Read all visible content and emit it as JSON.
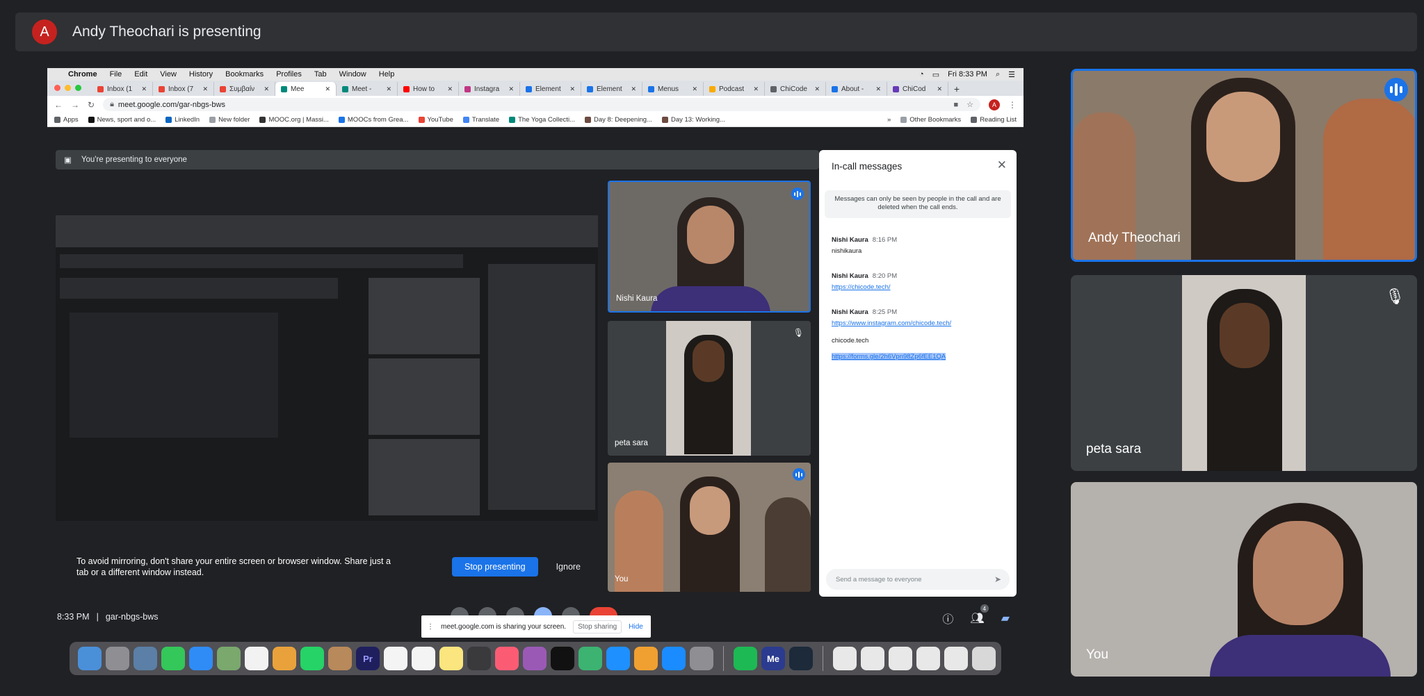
{
  "banner": {
    "avatar_letter": "A",
    "text": "Andy Theochari is presenting"
  },
  "mac_menu": {
    "items": [
      "Chrome",
      "File",
      "Edit",
      "View",
      "History",
      "Bookmarks",
      "Profiles",
      "Tab",
      "Window",
      "Help"
    ],
    "clock": "Fri 8:33 PM"
  },
  "tabs": [
    {
      "label": "Inbox (1",
      "color": "#ea4335"
    },
    {
      "label": "Inbox (7",
      "color": "#ea4335"
    },
    {
      "label": "Συμβαίν",
      "color": "#ea4335"
    },
    {
      "label": "Mee",
      "color": "#00897b",
      "active": true
    },
    {
      "label": "Meet - ",
      "color": "#00897b"
    },
    {
      "label": "How to ",
      "color": "#ff0000"
    },
    {
      "label": "Instagra",
      "color": "#c13584"
    },
    {
      "label": "Element",
      "color": "#1a73e8"
    },
    {
      "label": "Element",
      "color": "#1a73e8"
    },
    {
      "label": "Menus ",
      "color": "#1a73e8"
    },
    {
      "label": "Podcast",
      "color": "#f9ab00"
    },
    {
      "label": "ChiCode",
      "color": "#5f6368"
    },
    {
      "label": "About - ",
      "color": "#1a73e8"
    },
    {
      "label": "ChiCod",
      "color": "#673ab7"
    }
  ],
  "address": {
    "url": "meet.google.com/gar-nbgs-bws",
    "profile_letter": "A"
  },
  "bookmarks": {
    "items": [
      {
        "label": "Apps",
        "color": "#5f6368"
      },
      {
        "label": "News, sport and o...",
        "color": "#111"
      },
      {
        "label": "LinkedIn",
        "color": "#0a66c2"
      },
      {
        "label": "New folder",
        "color": "#9aa0a6"
      },
      {
        "label": "MOOC.org | Massi...",
        "color": "#333"
      },
      {
        "label": "MOOCs from Grea...",
        "color": "#1a73e8"
      },
      {
        "label": "YouTube",
        "color": "#ea4335"
      },
      {
        "label": "Translate",
        "color": "#4285f4"
      },
      {
        "label": "The Yoga Collecti...",
        "color": "#00897b"
      },
      {
        "label": "Day 8: Deepening...",
        "color": "#6d4c41"
      },
      {
        "label": "Day 13: Working...",
        "color": "#6d4c41"
      }
    ],
    "other": "Other Bookmarks",
    "reading": "Reading List"
  },
  "meet": {
    "presenting_bar": "You're presenting to everyone",
    "warning": "To avoid mirroring, don't share your entire screen or browser window. Share just a tab or a different window instead.",
    "stop_presenting": "Stop presenting",
    "ignore": "Ignore",
    "time": "8:33 PM",
    "meeting_code": "gar-nbgs-bws",
    "people_count": "4",
    "tiles": [
      {
        "name": "Nishi Kaura",
        "speaking": true
      },
      {
        "name": "peta sara",
        "muted": true
      },
      {
        "name": "You",
        "speaking": true
      }
    ]
  },
  "chat": {
    "title": "In-call messages",
    "note": "Messages can only be seen by people in the call and are deleted when the call ends.",
    "messages": [
      {
        "sender": "Nishi Kaura",
        "time": "8:16 PM",
        "lines": [
          "nishikaura"
        ]
      },
      {
        "sender": "Nishi Kaura",
        "time": "8:20 PM",
        "lines": [
          "https://chicode.tech/"
        ]
      },
      {
        "sender": "Nishi Kaura",
        "time": "8:25 PM",
        "lines": [
          "https://www.instagram.com/chicode.tech/",
          "chicode.tech",
          "https://forms.gle/2h6Vpn98Zp6fEE1QA"
        ]
      }
    ],
    "input_placeholder": "Send a message to everyone"
  },
  "share_notice": {
    "text": "meet.google.com is sharing your screen.",
    "stop": "Stop sharing",
    "hide": "Hide"
  },
  "side_tiles": [
    {
      "name": "Andy Theochari",
      "speaking": true
    },
    {
      "name": "peta sara",
      "muted": true
    },
    {
      "name": "You"
    }
  ],
  "icons": [
    "apple-icon",
    "chrome-icon",
    "star-icon",
    "camera-icon",
    "info-icon",
    "people-icon",
    "chat-icon",
    "close-icon",
    "send-icon",
    "mic-off-icon",
    "speaking-icon"
  ]
}
